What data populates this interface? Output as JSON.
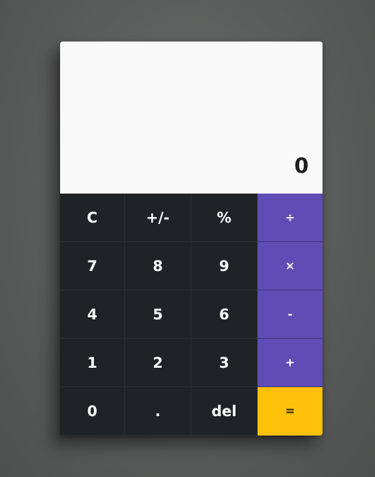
{
  "display": {
    "value": "0"
  },
  "keys": {
    "clear": "C",
    "negate": "+/-",
    "percent": "%",
    "divide": "÷",
    "seven": "7",
    "eight": "8",
    "nine": "9",
    "multiply": "×",
    "four": "4",
    "five": "5",
    "six": "6",
    "subtract": "-",
    "one": "1",
    "two": "2",
    "three": "3",
    "add": "+",
    "zero": "0",
    "decimal": ".",
    "delete": "del",
    "equals": "="
  },
  "colors": {
    "display_bg": "#f9f9f9",
    "keypad_bg": "#1f2326",
    "operator_bg": "#5f4cb4",
    "equals_bg": "#ffc107",
    "key_text": "#ffffff"
  }
}
